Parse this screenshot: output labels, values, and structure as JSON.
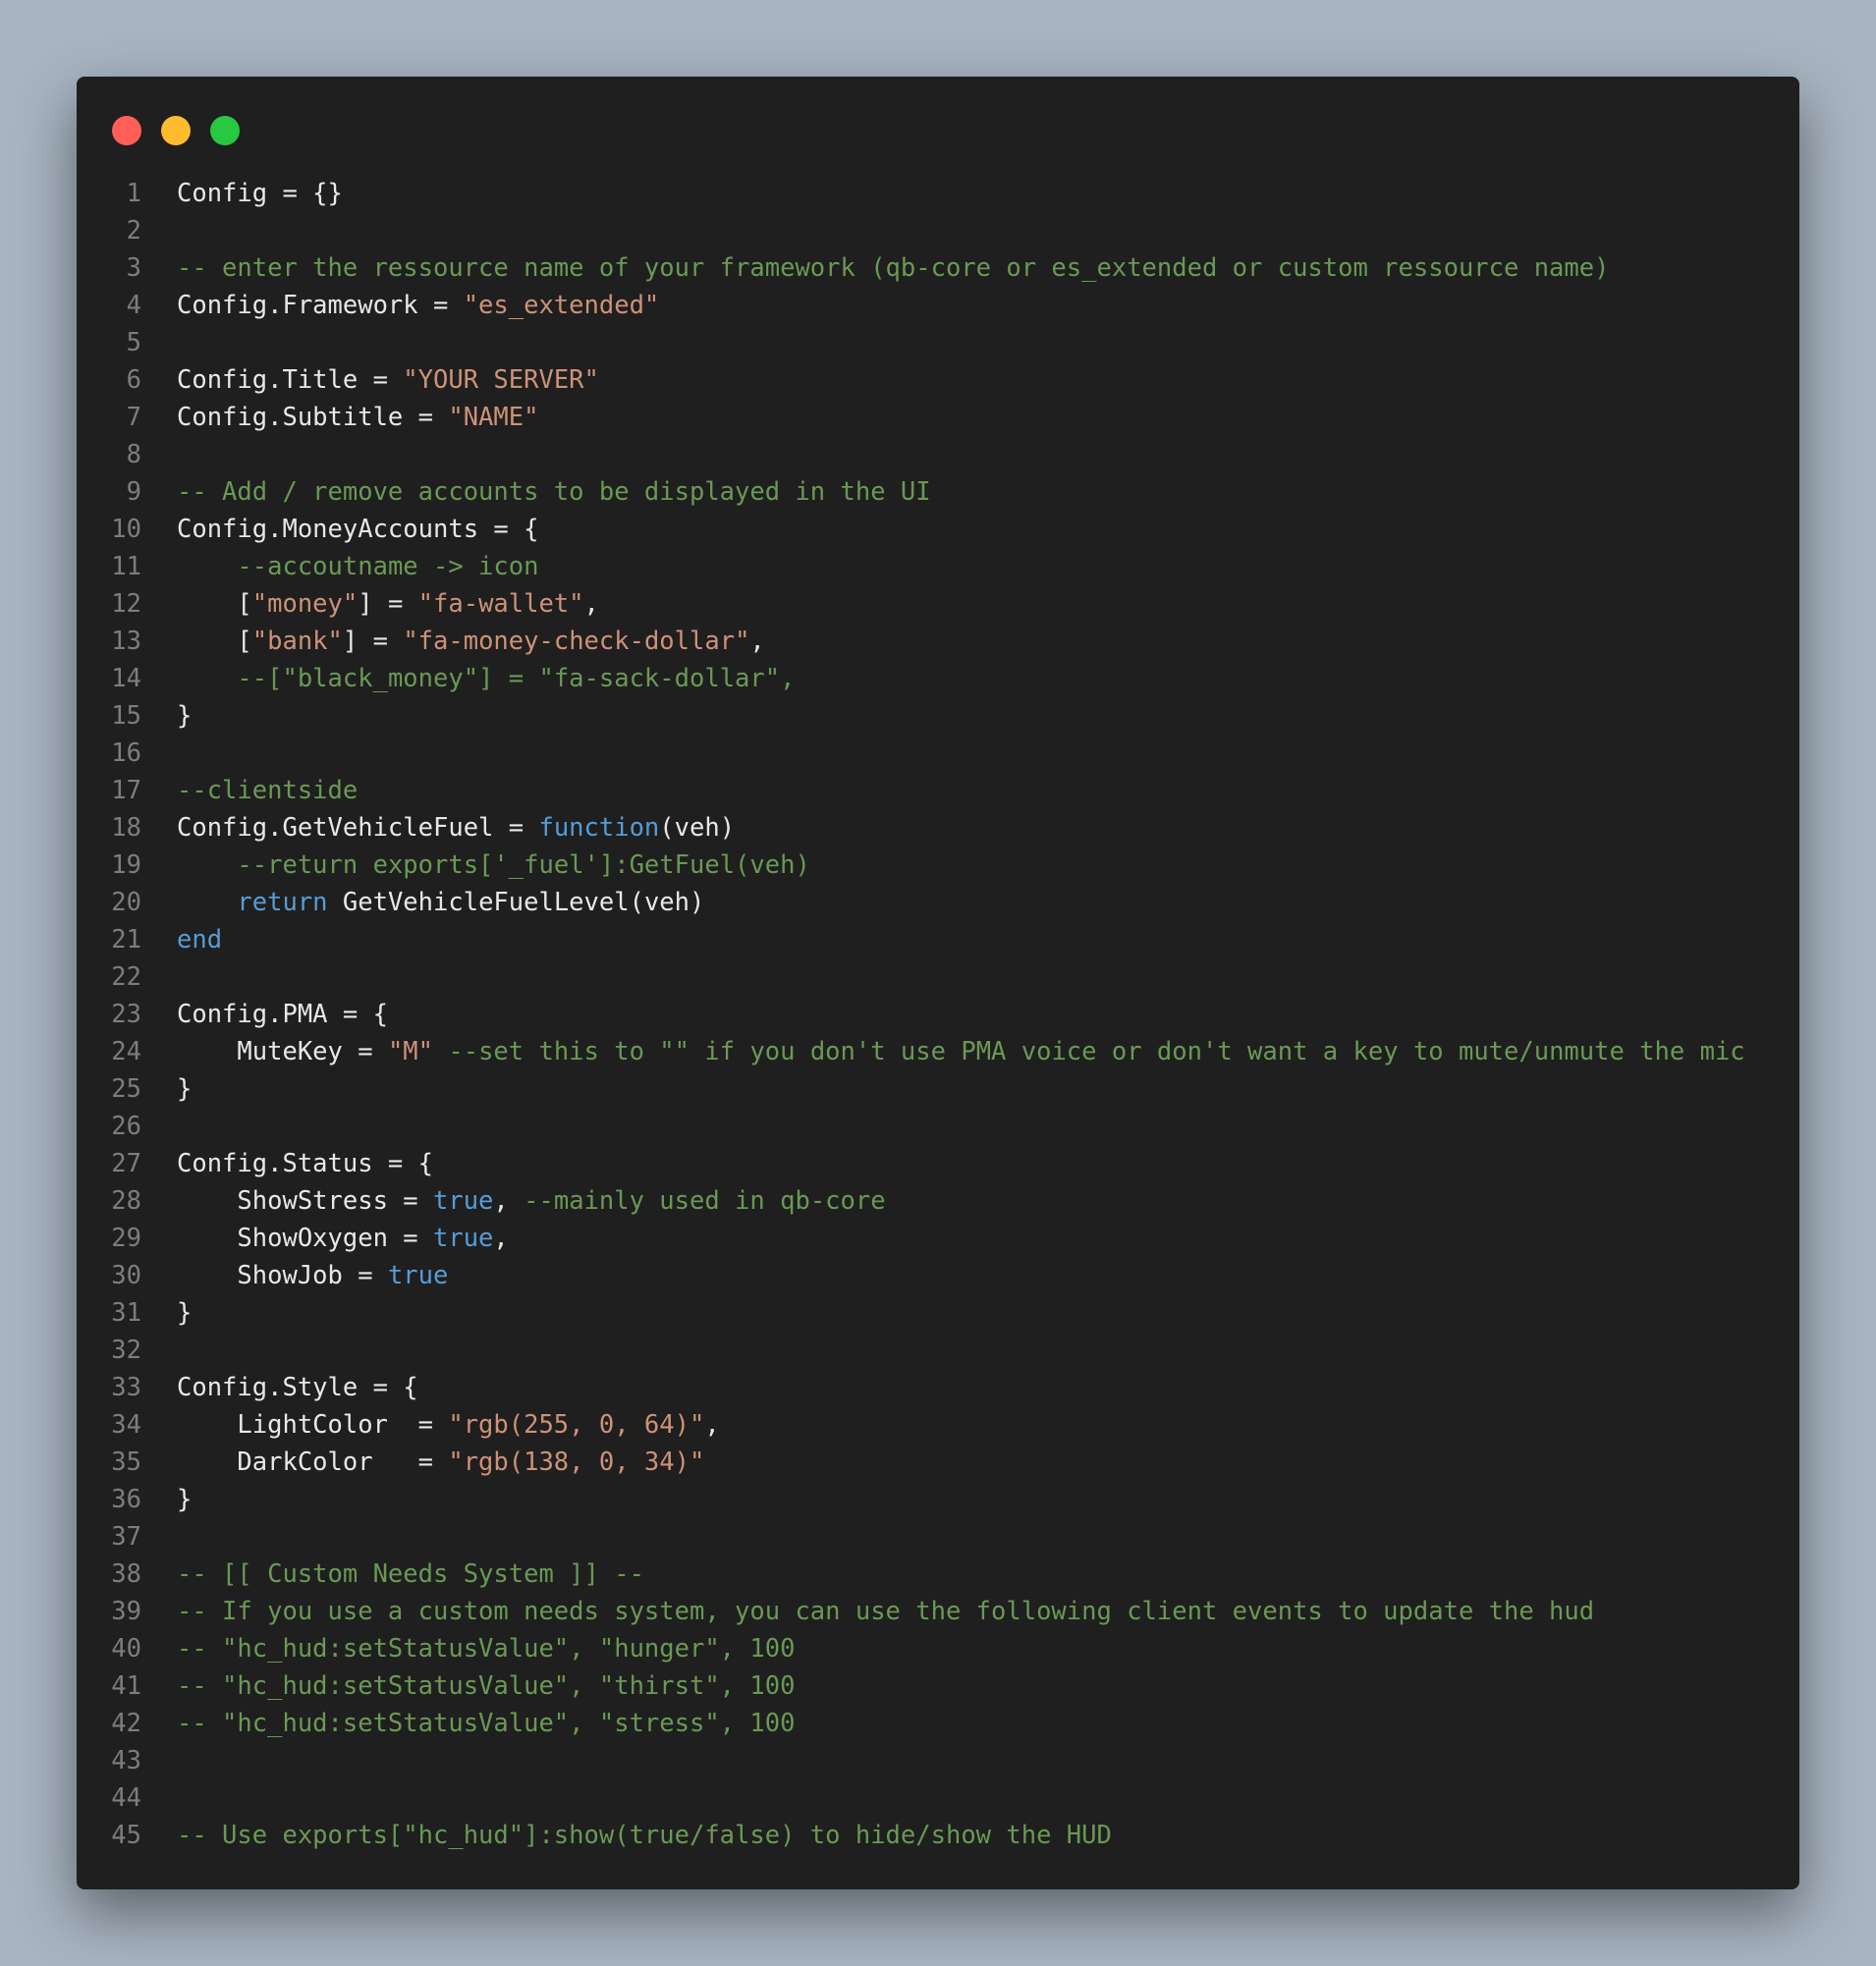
{
  "window": {
    "controls": [
      {
        "name": "close",
        "color": "#ff5f57"
      },
      {
        "name": "minimize",
        "color": "#febc2e"
      },
      {
        "name": "maximize",
        "color": "#28c840"
      }
    ]
  },
  "colors": {
    "background": "#a8b4c1",
    "editor": "#1f1f1f",
    "comment": "#6a9955",
    "string": "#ce9178",
    "keyword": "#569cd6",
    "number": "#b5cea8",
    "text": "#e8e8e8",
    "line_number": "#7d7d7d"
  },
  "code": {
    "lines": [
      {
        "n": "1",
        "tokens": [
          {
            "t": "Config = {}",
            "c": "id"
          }
        ]
      },
      {
        "n": "2",
        "tokens": []
      },
      {
        "n": "3",
        "tokens": [
          {
            "t": "-- enter the ressource name of your framework (qb-core or es_extended or custom ressource name)",
            "c": "com"
          }
        ]
      },
      {
        "n": "4",
        "tokens": [
          {
            "t": "Config.Framework = ",
            "c": "id"
          },
          {
            "t": "\"es_extended\"",
            "c": "str"
          }
        ]
      },
      {
        "n": "5",
        "tokens": []
      },
      {
        "n": "6",
        "tokens": [
          {
            "t": "Config.Title = ",
            "c": "id"
          },
          {
            "t": "\"YOUR SERVER\"",
            "c": "str"
          }
        ]
      },
      {
        "n": "7",
        "tokens": [
          {
            "t": "Config.Subtitle = ",
            "c": "id"
          },
          {
            "t": "\"NAME\"",
            "c": "str"
          }
        ]
      },
      {
        "n": "8",
        "tokens": []
      },
      {
        "n": "9",
        "tokens": [
          {
            "t": "-- Add / remove accounts to be displayed in the UI",
            "c": "com"
          }
        ]
      },
      {
        "n": "10",
        "tokens": [
          {
            "t": "Config.MoneyAccounts = {",
            "c": "id"
          }
        ]
      },
      {
        "n": "11",
        "tokens": [
          {
            "t": "    ",
            "c": "id"
          },
          {
            "t": "--accoutname -> icon",
            "c": "com"
          }
        ]
      },
      {
        "n": "12",
        "tokens": [
          {
            "t": "    [",
            "c": "id"
          },
          {
            "t": "\"money\"",
            "c": "str"
          },
          {
            "t": "] = ",
            "c": "id"
          },
          {
            "t": "\"fa-wallet\"",
            "c": "str"
          },
          {
            "t": ",",
            "c": "id"
          }
        ]
      },
      {
        "n": "13",
        "tokens": [
          {
            "t": "    [",
            "c": "id"
          },
          {
            "t": "\"bank\"",
            "c": "str"
          },
          {
            "t": "] = ",
            "c": "id"
          },
          {
            "t": "\"fa-money-check-dollar\"",
            "c": "str"
          },
          {
            "t": ",",
            "c": "id"
          }
        ]
      },
      {
        "n": "14",
        "tokens": [
          {
            "t": "    ",
            "c": "id"
          },
          {
            "t": "--[\"black_money\"] = \"fa-sack-dollar\",",
            "c": "com"
          }
        ]
      },
      {
        "n": "15",
        "tokens": [
          {
            "t": "}",
            "c": "id"
          }
        ]
      },
      {
        "n": "16",
        "tokens": []
      },
      {
        "n": "17",
        "tokens": [
          {
            "t": "--clientside",
            "c": "com"
          }
        ]
      },
      {
        "n": "18",
        "tokens": [
          {
            "t": "Config.GetVehicleFuel = ",
            "c": "id"
          },
          {
            "t": "function",
            "c": "kw"
          },
          {
            "t": "(veh)",
            "c": "id"
          }
        ]
      },
      {
        "n": "19",
        "tokens": [
          {
            "t": "    ",
            "c": "id"
          },
          {
            "t": "--return exports['_fuel']:GetFuel(veh)",
            "c": "com"
          }
        ]
      },
      {
        "n": "20",
        "tokens": [
          {
            "t": "    ",
            "c": "id"
          },
          {
            "t": "return",
            "c": "kw"
          },
          {
            "t": " GetVehicleFuelLevel(veh)",
            "c": "id"
          }
        ]
      },
      {
        "n": "21",
        "tokens": [
          {
            "t": "end",
            "c": "kw"
          }
        ]
      },
      {
        "n": "22",
        "tokens": []
      },
      {
        "n": "23",
        "tokens": [
          {
            "t": "Config.PMA = {",
            "c": "id"
          }
        ]
      },
      {
        "n": "24",
        "tokens": [
          {
            "t": "    MuteKey = ",
            "c": "id"
          },
          {
            "t": "\"M\"",
            "c": "str"
          },
          {
            "t": " ",
            "c": "id"
          },
          {
            "t": "--set this to \"\" if you don't use PMA voice or don't want a key to mute/unmute the mic",
            "c": "com"
          }
        ]
      },
      {
        "n": "25",
        "tokens": [
          {
            "t": "}",
            "c": "id"
          }
        ]
      },
      {
        "n": "26",
        "tokens": []
      },
      {
        "n": "27",
        "tokens": [
          {
            "t": "Config.Status = {",
            "c": "id"
          }
        ]
      },
      {
        "n": "28",
        "tokens": [
          {
            "t": "    ShowStress = ",
            "c": "id"
          },
          {
            "t": "true",
            "c": "kw"
          },
          {
            "t": ", ",
            "c": "id"
          },
          {
            "t": "--mainly used in qb-core",
            "c": "com"
          }
        ]
      },
      {
        "n": "29",
        "tokens": [
          {
            "t": "    ShowOxygen = ",
            "c": "id"
          },
          {
            "t": "true",
            "c": "kw"
          },
          {
            "t": ",",
            "c": "id"
          }
        ]
      },
      {
        "n": "30",
        "tokens": [
          {
            "t": "    ShowJob = ",
            "c": "id"
          },
          {
            "t": "true",
            "c": "kw"
          }
        ]
      },
      {
        "n": "31",
        "tokens": [
          {
            "t": "}",
            "c": "id"
          }
        ]
      },
      {
        "n": "32",
        "tokens": []
      },
      {
        "n": "33",
        "tokens": [
          {
            "t": "Config.Style = {",
            "c": "id"
          }
        ]
      },
      {
        "n": "34",
        "tokens": [
          {
            "t": "    LightColor  = ",
            "c": "id"
          },
          {
            "t": "\"rgb(255, 0, 64)\"",
            "c": "str"
          },
          {
            "t": ",",
            "c": "id"
          }
        ]
      },
      {
        "n": "35",
        "tokens": [
          {
            "t": "    DarkColor   = ",
            "c": "id"
          },
          {
            "t": "\"rgb(138, 0, 34)\"",
            "c": "str"
          }
        ]
      },
      {
        "n": "36",
        "tokens": [
          {
            "t": "}",
            "c": "id"
          }
        ]
      },
      {
        "n": "37",
        "tokens": []
      },
      {
        "n": "38",
        "tokens": [
          {
            "t": "-- [[ Custom Needs System ]] --",
            "c": "com"
          }
        ]
      },
      {
        "n": "39",
        "tokens": [
          {
            "t": "-- If you use a custom needs system, you can use the following client events to update the hud",
            "c": "com"
          }
        ]
      },
      {
        "n": "40",
        "tokens": [
          {
            "t": "-- \"hc_hud:setStatusValue\", \"hunger\", 100",
            "c": "com"
          }
        ]
      },
      {
        "n": "41",
        "tokens": [
          {
            "t": "-- \"hc_hud:setStatusValue\", \"thirst\", 100",
            "c": "com"
          }
        ]
      },
      {
        "n": "42",
        "tokens": [
          {
            "t": "-- \"hc_hud:setStatusValue\", \"stress\", 100",
            "c": "com"
          }
        ]
      },
      {
        "n": "43",
        "tokens": []
      },
      {
        "n": "44",
        "tokens": []
      },
      {
        "n": "45",
        "tokens": [
          {
            "t": "-- Use exports[\"hc_hud\"]:show(true/false) to hide/show the HUD",
            "c": "com"
          }
        ]
      }
    ]
  }
}
